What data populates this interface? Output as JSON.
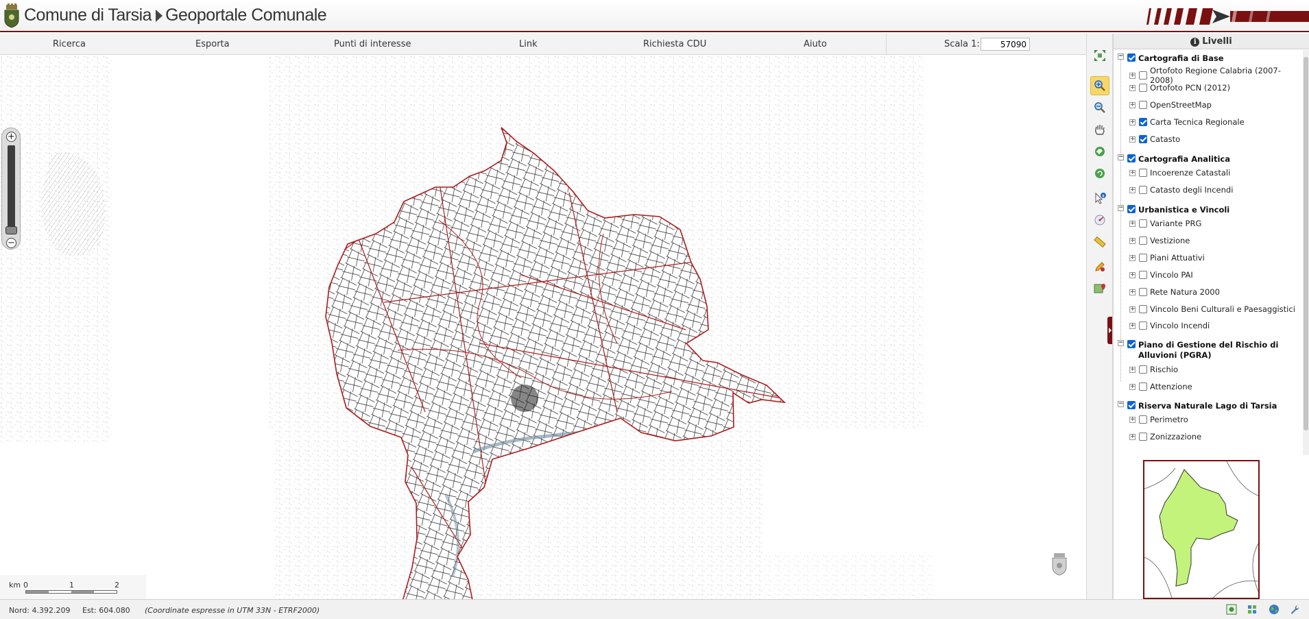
{
  "header": {
    "municipality": "Comune di Tarsia",
    "portal": "Geoportale Comunale"
  },
  "menu": [
    "Ricerca",
    "Esporta",
    "Punti di interesse",
    "Link",
    "Richiesta CDU",
    "Aiuto"
  ],
  "scale": {
    "label": "Scala 1:",
    "value": "57090"
  },
  "scalebar": {
    "unit": "km",
    "ticks": [
      "0",
      "1",
      "2"
    ]
  },
  "tools": [
    "zoom-extent-icon",
    "zoom-in-icon",
    "zoom-out-icon",
    "pan-hand-icon",
    "history-back-icon",
    "history-forward-icon",
    "identify-icon",
    "measure-angle-icon",
    "measure-ruler-icon",
    "edit-pencil-icon",
    "map-search-icon"
  ],
  "panel": {
    "title": "Livelli",
    "groups": [
      {
        "label": "Cartografia di Base",
        "checked": true,
        "items": [
          {
            "label": "Ortofoto Regione Calabria (2007-2008)",
            "checked": false
          },
          {
            "label": "Ortofoto PCN (2012)",
            "checked": false
          },
          {
            "label": "OpenStreetMap",
            "checked": false
          },
          {
            "label": "Carta Tecnica Regionale",
            "checked": true
          },
          {
            "label": "Catasto",
            "checked": true
          }
        ]
      },
      {
        "label": "Cartografia Analitica",
        "checked": true,
        "items": [
          {
            "label": "Incoerenze Catastali",
            "checked": false
          },
          {
            "label": "Catasto degli Incendi",
            "checked": false
          }
        ]
      },
      {
        "label": "Urbanistica e Vincoli",
        "checked": true,
        "items": [
          {
            "label": "Variante PRG",
            "checked": false
          },
          {
            "label": "Vestizione",
            "checked": false
          },
          {
            "label": "Piani Attuativi",
            "checked": false
          },
          {
            "label": "Vincolo PAI",
            "checked": false
          },
          {
            "label": "Rete Natura 2000",
            "checked": false
          },
          {
            "label": "Vincolo Beni Culturali e Paesaggistici",
            "checked": false
          },
          {
            "label": "Vincolo Incendi",
            "checked": false
          }
        ]
      },
      {
        "label": "Piano di Gestione del Rischio di Alluvioni (PGRA)",
        "checked": true,
        "items": [
          {
            "label": "Rischio",
            "checked": false
          },
          {
            "label": "Attenzione",
            "checked": false
          }
        ]
      },
      {
        "label": "Riserva Naturale Lago di Tarsia",
        "checked": true,
        "items": [
          {
            "label": "Perimetro",
            "checked": false
          },
          {
            "label": "Zonizzazione",
            "checked": false
          }
        ]
      }
    ]
  },
  "status": {
    "nord": "Nord: 4.392.209",
    "est": "Est: 604.080",
    "note": "(Coordinate espresse in UTM 33N - ETRF2000)"
  },
  "colors": {
    "accent": "#7a1010",
    "boundary": "#b01818",
    "overview_fill": "#c3f37a"
  }
}
